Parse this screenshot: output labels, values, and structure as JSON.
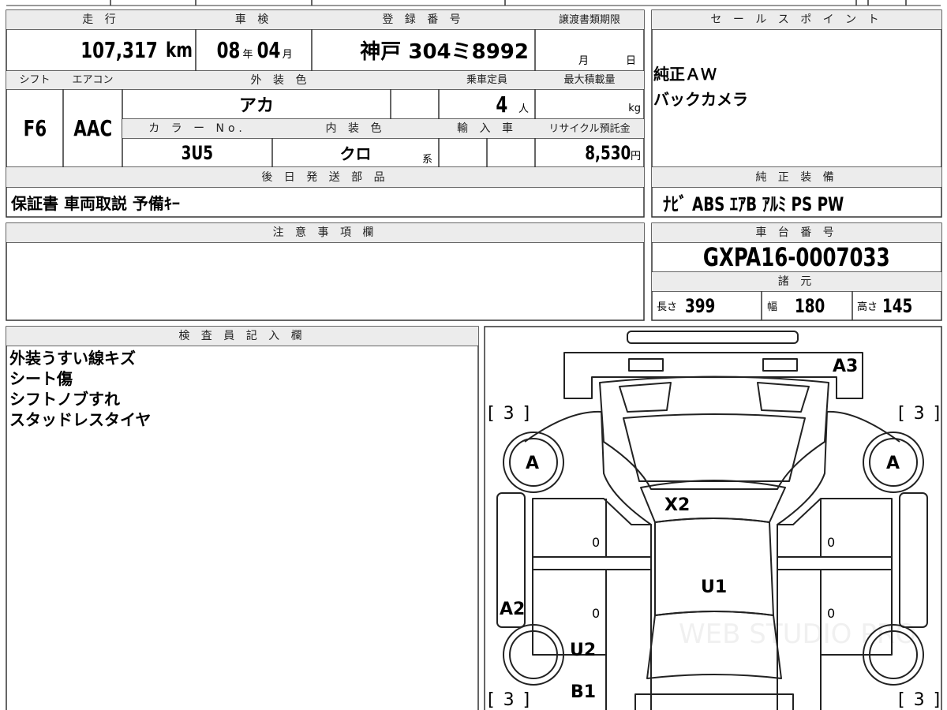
{
  "vehicle": {
    "mileage_header": "走 行",
    "mileage_value": "107,317",
    "mileage_unit": "km",
    "shaken_header": "車 検",
    "shaken_year": "08",
    "shaken_year_unit": "年",
    "shaken_month": "04",
    "shaken_month_unit": "月",
    "reg_header": "登 録 番 号",
    "reg_value": "神戸 304ミ8992",
    "transfer_header": "譲渡書類期限",
    "transfer_month": "月",
    "transfer_day": "日",
    "shift_header": "シフト",
    "shift_value": "F6",
    "ac_header": "エアコン",
    "ac_value": "AAC",
    "exterior_header": "外 装 色",
    "exterior_value": "アカ",
    "capacity_header": "乗車定員",
    "capacity_value": "4",
    "capacity_unit": "人",
    "maxload_header": "最大積載量",
    "maxload_unit": "kg",
    "colorno_header": "カ ラ ー No.",
    "colorno_value": "3U5",
    "interior_header": "内 装 色",
    "interior_value": "クロ",
    "interior_unit": "系",
    "import_header": "輸 入 車",
    "recycle_header": "リサイクル預託金",
    "recycle_value": "8,530",
    "recycle_unit": "円",
    "parts_header": "後 日 発 送 部 品",
    "parts_value": "保証書 車両取説 予備ｷｰ"
  },
  "sales": {
    "header": "セ ー ル ス ポ イ ン ト",
    "lines": [
      "純正ＡＷ",
      "バックカメラ"
    ]
  },
  "equipment": {
    "header": "純 正 装 備",
    "value": "ﾅﾋﾞ ABS ｴｱB ｱﾙﾐ PS PW"
  },
  "notes": {
    "header": "注 意 事 項 欄"
  },
  "chassis": {
    "header": "車 台 番 号",
    "value": "GXPA16-0007033",
    "spec_header": "諸 元",
    "length_label": "長さ",
    "length_value": "399",
    "width_label": "幅",
    "width_value": "180",
    "height_label": "高さ",
    "height_value": "145"
  },
  "inspector": {
    "header": "検 査 員 記 入 欄",
    "lines": [
      "外装うすい線キズ",
      "シート傷",
      "シフトノブすれ",
      "スタッドレスタイヤ"
    ]
  },
  "diagram": {
    "marks": {
      "a3": "A3",
      "a_left": "A",
      "a_right": "A",
      "x2": "X2",
      "u1": "U1",
      "a2": "A2",
      "u2": "U2",
      "b1": "B1",
      "tire_tl": "[ 3 ]",
      "tire_tr": "[ 3 ]",
      "tire_bl": "[ 3 ]",
      "tire_br": "[ 3 ]",
      "zero_l1": "0",
      "zero_l2": "0",
      "zero_r1": "0",
      "zero_r2": "0"
    },
    "watermark": "WEB STUDIO PRO"
  }
}
